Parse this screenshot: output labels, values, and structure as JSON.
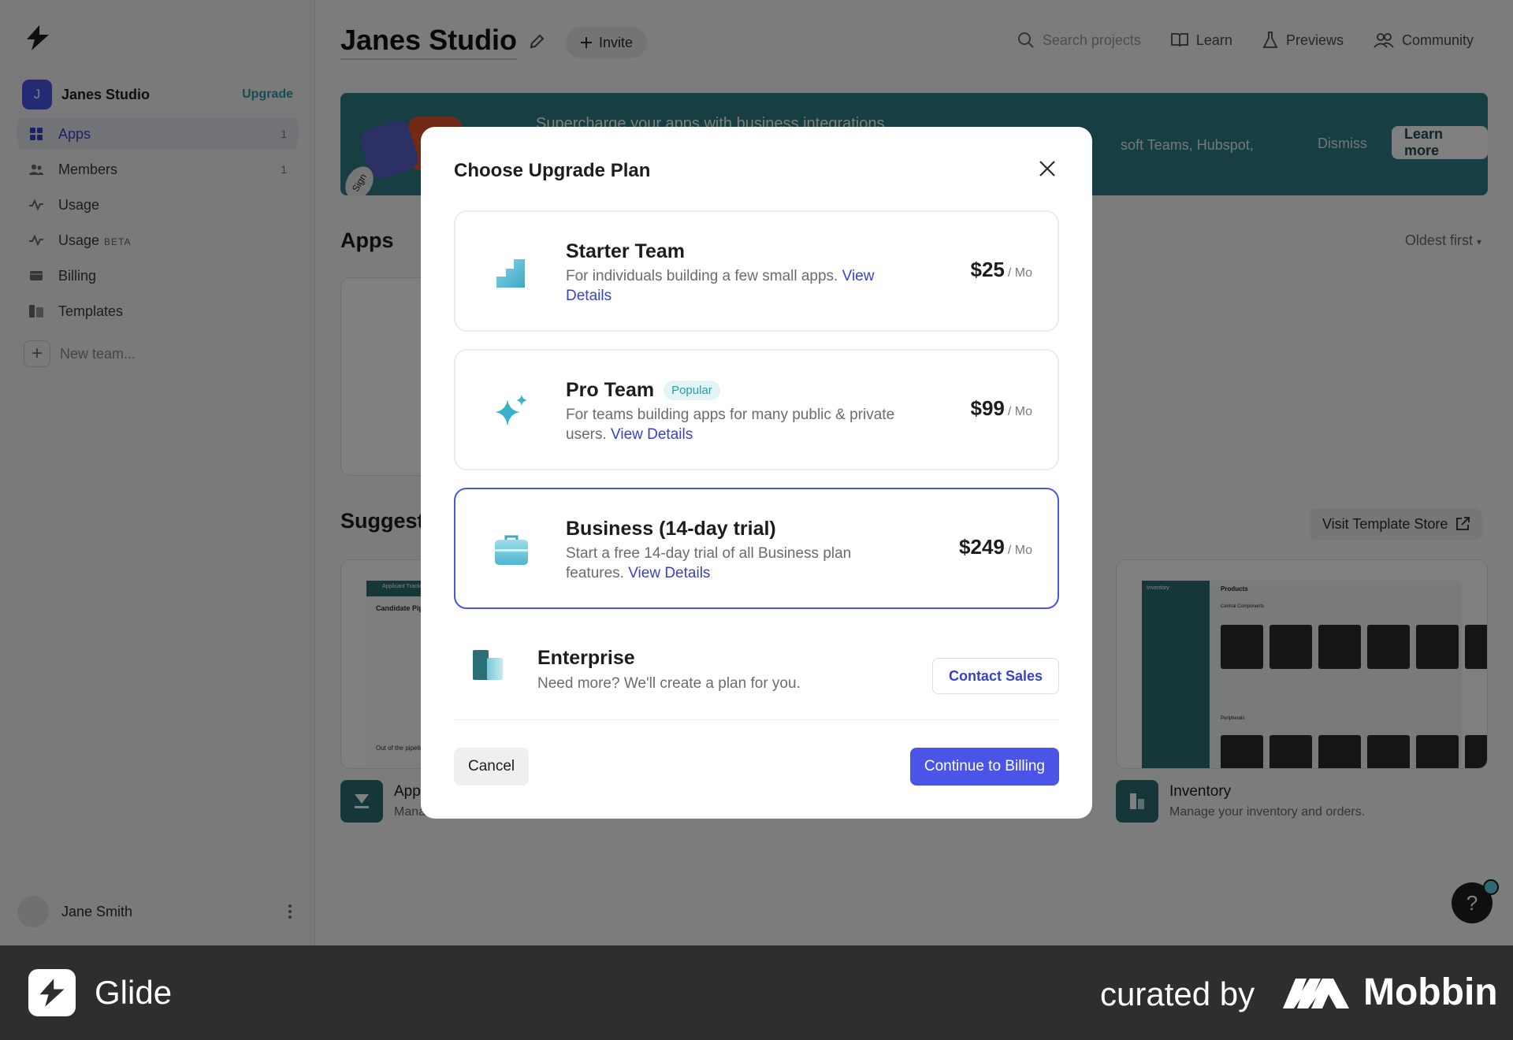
{
  "sidebar": {
    "team": {
      "initial": "J",
      "name": "Janes Studio",
      "upgrade_label": "Upgrade"
    },
    "nav": [
      {
        "label": "Apps",
        "count": "1",
        "icon": "grid-icon"
      },
      {
        "label": "Members",
        "count": "1",
        "icon": "members-icon"
      },
      {
        "label": "Usage",
        "count": "",
        "icon": "activity-icon"
      },
      {
        "label": "Usage",
        "badge": "BETA",
        "count": "",
        "icon": "activity-icon"
      },
      {
        "label": "Billing",
        "count": "",
        "icon": "card-icon"
      },
      {
        "label": "Templates",
        "count": "",
        "icon": "templates-icon"
      }
    ],
    "new_team_label": "New team...",
    "user": {
      "name": "Jane Smith"
    }
  },
  "header": {
    "title": "Janes Studio",
    "invite_label": "Invite",
    "search_placeholder": "Search projects",
    "links": {
      "learn": "Learn",
      "previews": "Previews",
      "community": "Community"
    }
  },
  "banner": {
    "title": "Supercharge your apps with business integrations",
    "text": "soft Teams, Hubspot,",
    "dismiss_label": "Dismiss",
    "learn_more_label": "Learn more",
    "sticker": "Sign"
  },
  "apps_section": {
    "title": "Apps",
    "sort_label": "Oldest first"
  },
  "suggested_section": {
    "title": "Suggested",
    "visit_store_label": "Visit Template Store"
  },
  "templates": [
    {
      "title": "App",
      "desc": "Mana",
      "shot_title": "Applicant Tracker",
      "shot_heading": "Candidate Pipeline",
      "shot_footer": "Out of the pipeline"
    },
    {
      "title": "Inventory",
      "desc": "Manage your inventory and orders.",
      "shot_title": "Inventory",
      "shot_heading": "Products",
      "shot_sub1": "Central Components",
      "shot_sub2": "Peripherals"
    }
  ],
  "modal": {
    "title": "Choose Upgrade Plan",
    "plans": [
      {
        "name": "Starter Team",
        "badge": "",
        "desc": "For individuals building a few small apps.",
        "link": "View Details",
        "price": "$25",
        "per": "/ Mo",
        "selected": false
      },
      {
        "name": "Pro Team",
        "badge": "Popular",
        "desc": "For teams building apps for many public & private users.",
        "link": "View Details",
        "price": "$99",
        "per": "/ Mo",
        "selected": false
      },
      {
        "name": "Business (14-day trial)",
        "badge": "",
        "desc": "Start a free 14-day trial of all Business plan features.",
        "link": "View Details",
        "price": "$249",
        "per": "/ Mo",
        "selected": true
      }
    ],
    "enterprise": {
      "name": "Enterprise",
      "desc": "Need more? We'll create a plan for you.",
      "contact_label": "Contact Sales"
    },
    "cancel_label": "Cancel",
    "continue_label": "Continue to Billing"
  },
  "help": {
    "label": "?"
  },
  "footer": {
    "brand": "Glide",
    "curated_by": "curated by",
    "curator": "Mobbin"
  },
  "colors": {
    "accent": "#4a55e8",
    "teal": "#2f7c86",
    "link": "#3643c8"
  }
}
